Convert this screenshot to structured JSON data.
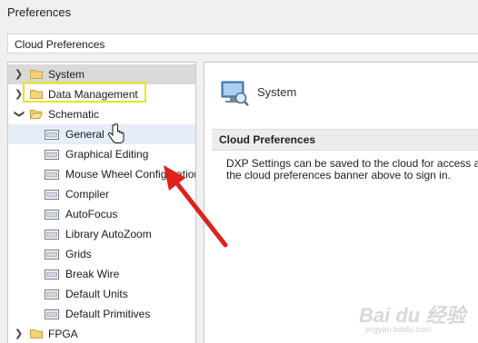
{
  "window": {
    "title": "Preferences"
  },
  "cloud_bar": {
    "label": "Cloud Preferences"
  },
  "tree": {
    "items": [
      {
        "label": "System",
        "level": "top",
        "expanded": false,
        "selected": true
      },
      {
        "label": "Data Management",
        "level": "top",
        "expanded": false
      },
      {
        "label": "Schematic",
        "level": "top",
        "expanded": true
      },
      {
        "label": "General",
        "level": "child",
        "hover": true
      },
      {
        "label": "Graphical Editing",
        "level": "child",
        "highlighted": true
      },
      {
        "label": "Mouse Wheel Configuration",
        "level": "child"
      },
      {
        "label": "Compiler",
        "level": "child"
      },
      {
        "label": "AutoFocus",
        "level": "child"
      },
      {
        "label": "Library AutoZoom",
        "level": "child"
      },
      {
        "label": "Grids",
        "level": "child"
      },
      {
        "label": "Break Wire",
        "level": "child"
      },
      {
        "label": "Default Units",
        "level": "child"
      },
      {
        "label": "Default Primitives",
        "level": "child"
      },
      {
        "label": "FPGA",
        "level": "top",
        "expanded": false
      }
    ]
  },
  "main": {
    "page_title": "System",
    "section_title": "Cloud Preferences",
    "description_line1": "DXP Settings can be saved to the cloud for access any",
    "description_line2": "the cloud preferences banner above to sign in."
  },
  "watermark": {
    "text": "Bai du 经验",
    "subtext": "jingyan.baidu.com"
  },
  "colors": {
    "selected_row": "#d9d9d9",
    "hover_row": "#e5eef8",
    "highlight_box": "#e6e61a",
    "annotation_arrow": "#e0201c"
  }
}
